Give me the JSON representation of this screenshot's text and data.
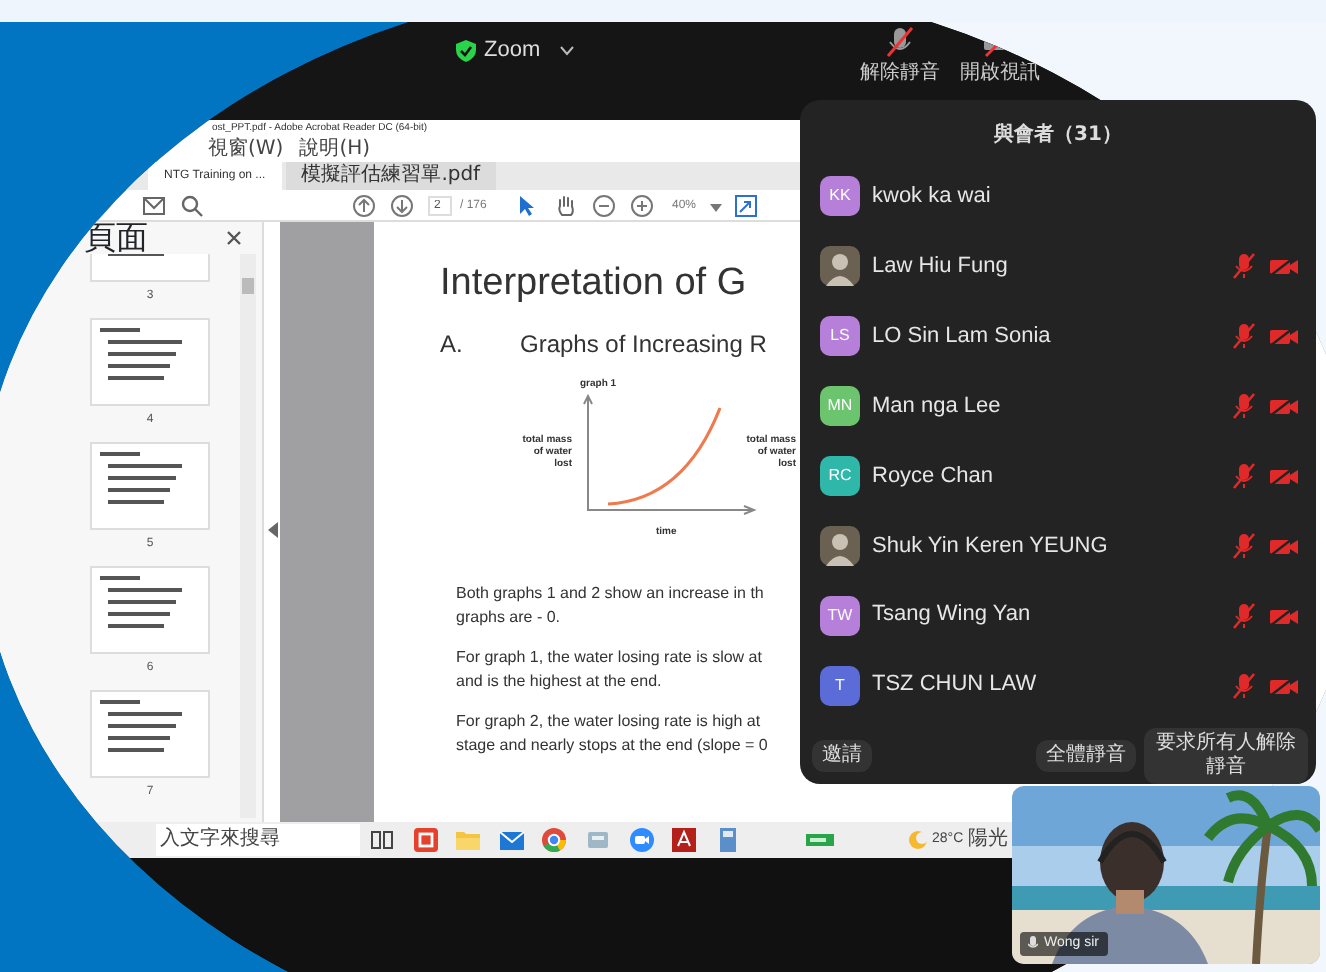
{
  "zoom_bar": {
    "title": "Zoom",
    "controls": [
      {
        "kind": "mic",
        "label": "解除靜音"
      },
      {
        "kind": "video",
        "label": "開啟視訊"
      }
    ]
  },
  "acrobat": {
    "title": "ost_PPT.pdf - Adobe Acrobat Reader DC (64-bit)",
    "menus": [
      "視窗(W)",
      "說明(H)"
    ],
    "tabs": [
      {
        "label": "NTG Training on ...",
        "selected": true
      },
      {
        "label": "模擬評估練習單.pdf",
        "selected": false
      }
    ],
    "page_number": "2",
    "page_count": "/ 176",
    "zoom_level": "40%",
    "pane_title": "頁面",
    "thumbnails": [
      {
        "page": "3"
      },
      {
        "page": "4"
      },
      {
        "page": "5"
      },
      {
        "page": "6"
      },
      {
        "page": "7"
      }
    ],
    "document": {
      "heading": "Interpretation of G",
      "section_letter": "A.",
      "section_title": "Graphs of Increasing R",
      "graph": {
        "title": "graph 1",
        "y_label": "total mass of water lost",
        "x_label": "time",
        "next_y_label": "total mass of water lost"
      },
      "paragraphs": [
        [
          "Both graphs 1 and 2 show an increase in th",
          "graphs are  - 0."
        ],
        [
          "For graph 1, the water losing rate is slow at",
          "and is the highest at the end."
        ],
        [
          "For graph 2, the water losing rate is high at",
          "stage and nearly stops at the end (slope = 0"
        ]
      ]
    }
  },
  "taskbar": {
    "search": "入文字來搜尋",
    "temperature": "28°C",
    "weather": "陽光"
  },
  "participants_panel": {
    "title": "與會者（31）",
    "participants": [
      {
        "kind": "initials",
        "initials": "KK",
        "color": "#b67fd9",
        "name": "kwok ka wai",
        "audio_muted": false,
        "video_off": false
      },
      {
        "name": "Law Hiu Fung",
        "audio_muted": true,
        "video_off": true
      },
      {
        "kind": "initials",
        "initials": "LS",
        "color": "#b67fd9",
        "name": "LO Sin Lam Sonia",
        "audio_muted": true,
        "video_off": true
      },
      {
        "kind": "initials",
        "initials": "MN",
        "color": "#6cc46f",
        "name": "Man nga Lee",
        "audio_muted": true,
        "video_off": true
      },
      {
        "kind": "initials",
        "initials": "RC",
        "color": "#2fb8aa",
        "name": "Royce Chan",
        "audio_muted": true,
        "video_off": true
      },
      {
        "name": "Shuk Yin Keren YEUNG",
        "audio_muted": true,
        "video_off": true
      },
      {
        "kind": "initials",
        "initials": "TW",
        "color": "#b67fd9",
        "name": "Tsang Wing Yan",
        "audio_muted": true,
        "video_off": true
      },
      {
        "kind": "initials",
        "initials": "T",
        "color": "#5b6bd8",
        "name": "TSZ CHUN LAW",
        "audio_muted": true,
        "video_off": true
      }
    ],
    "buttons": [
      "邀請",
      "全體靜音",
      "要求所有人解除靜音"
    ]
  },
  "video_tile": {
    "name": "Wong sir"
  }
}
